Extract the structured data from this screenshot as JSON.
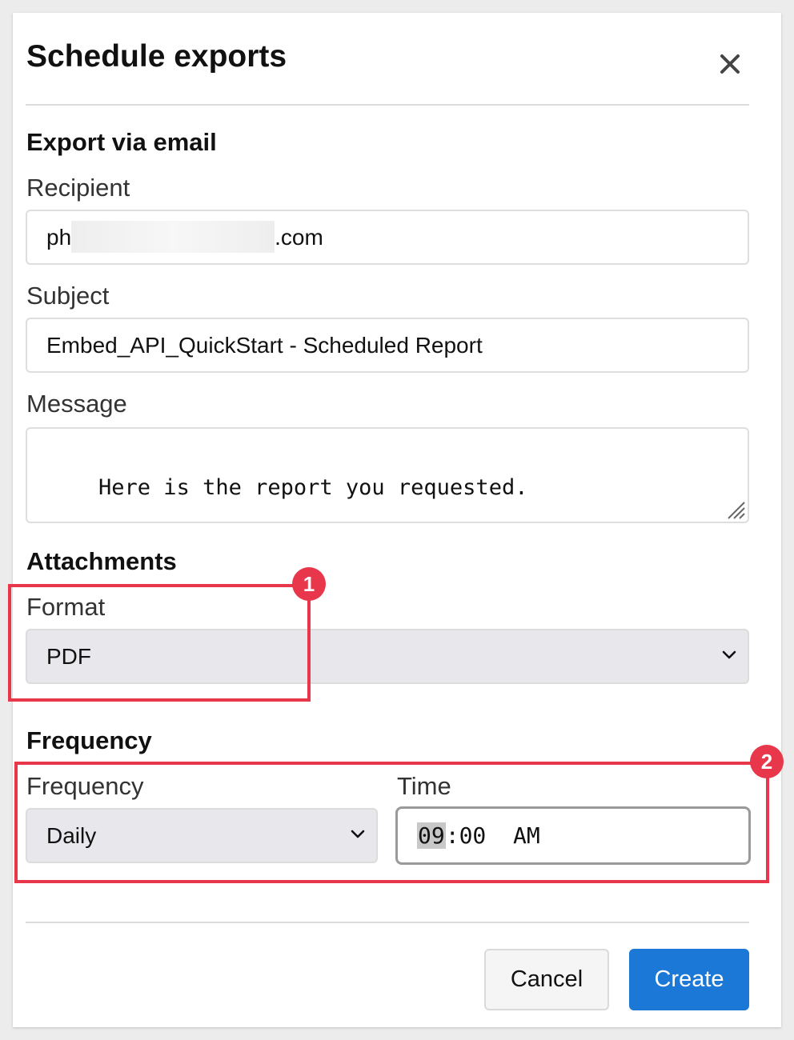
{
  "dialog": {
    "title": "Schedule exports"
  },
  "email_section": {
    "title": "Export via email",
    "recipient_label": "Recipient",
    "recipient_prefix": "ph",
    "recipient_suffix": ".com",
    "subject_label": "Subject",
    "subject_value": "Embed_API_QuickStart - Scheduled Report",
    "message_label": "Message",
    "message_value": "Here is the report you requested."
  },
  "attachments_section": {
    "title": "Attachments",
    "format_label": "Format",
    "format_value": "PDF"
  },
  "frequency_section": {
    "title": "Frequency",
    "frequency_label": "Frequency",
    "frequency_value": "Daily",
    "time_label": "Time",
    "time_hour": "09",
    "time_separator": ":",
    "time_minute": "00",
    "time_period": "AM"
  },
  "footer": {
    "cancel_label": "Cancel",
    "create_label": "Create"
  },
  "annotations": {
    "badge_1": "1",
    "badge_2": "2"
  },
  "colors": {
    "accent": "#1b78d6",
    "annotation": "#e8364a"
  }
}
